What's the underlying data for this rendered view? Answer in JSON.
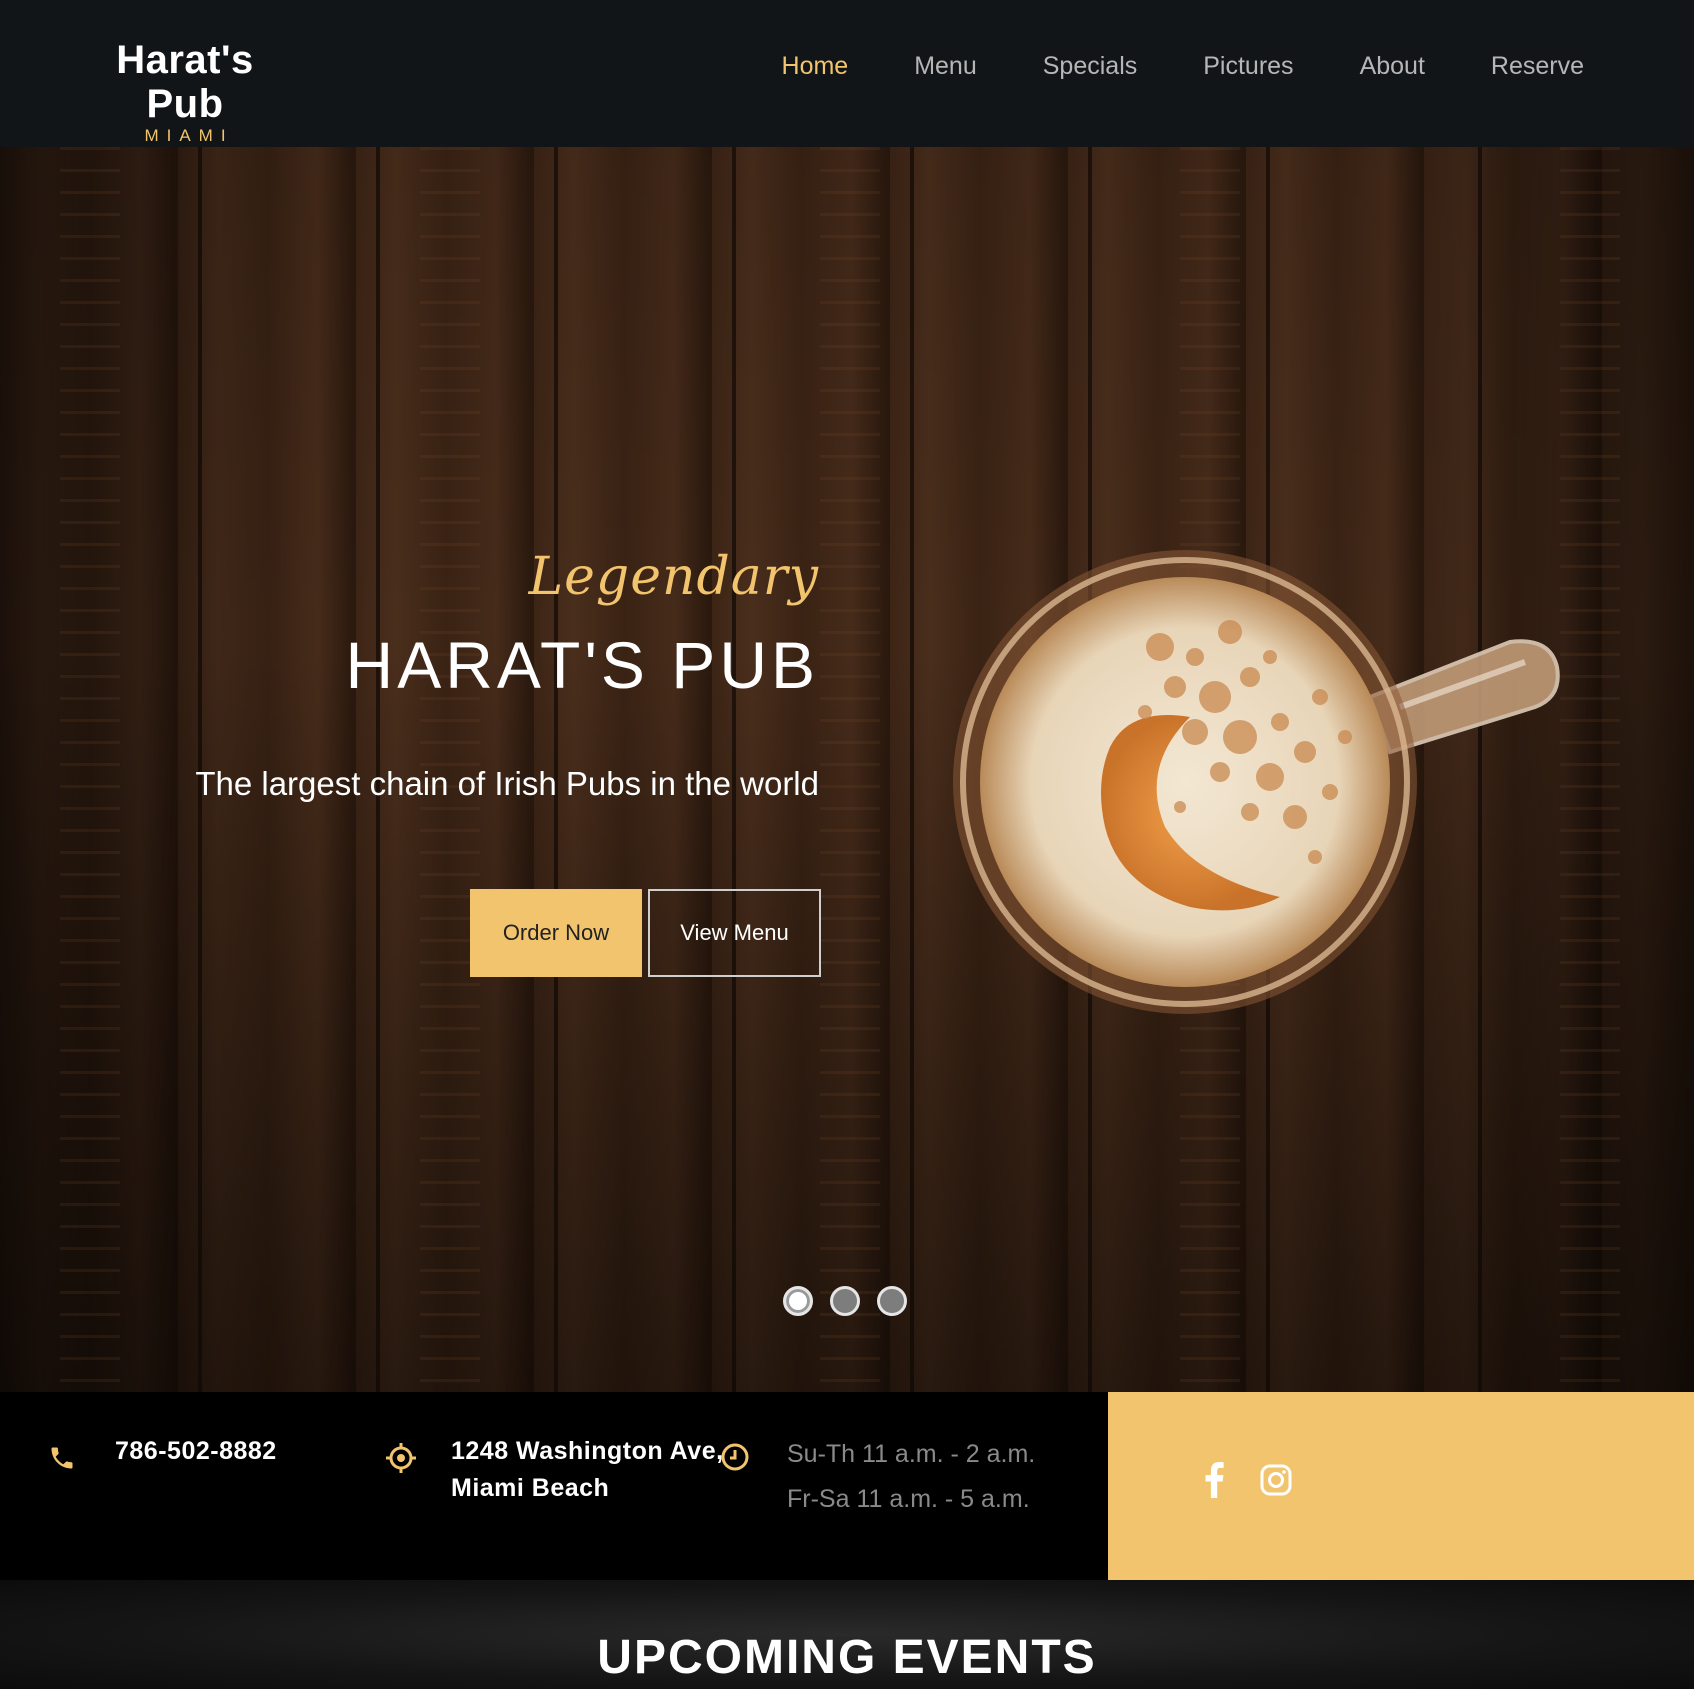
{
  "brand": {
    "name": "Harat's Pub",
    "city": "MIAMI"
  },
  "nav": {
    "items": [
      {
        "label": "Home",
        "active": true
      },
      {
        "label": "Menu",
        "active": false
      },
      {
        "label": "Specials",
        "active": false
      },
      {
        "label": "Pictures",
        "active": false
      },
      {
        "label": "About",
        "active": false
      },
      {
        "label": "Reserve",
        "active": false
      }
    ]
  },
  "hero": {
    "eyebrow": "Legendary",
    "title": "HARAT'S PUB",
    "subtitle": "The largest chain of Irish Pubs in the world",
    "primary_button": "Order Now",
    "secondary_button": "View Menu",
    "slide_count": 3,
    "active_slide": 1
  },
  "info": {
    "phone": "786-502-8882",
    "address_line1": "1248 Washington Ave,",
    "address_line2": "Miami Beach",
    "hours_line1": "Su-Th 11 a.m. - 2 a.m.",
    "hours_line2": "Fr-Sa 11 a.m. - 5 a.m."
  },
  "social": {
    "icons": [
      "facebook-icon",
      "instagram-icon"
    ]
  },
  "events": {
    "title": "UPCOMING EVENTS"
  },
  "colors": {
    "accent": "#f2c46d",
    "header_bg": "#121517",
    "info_bg": "#000000"
  }
}
